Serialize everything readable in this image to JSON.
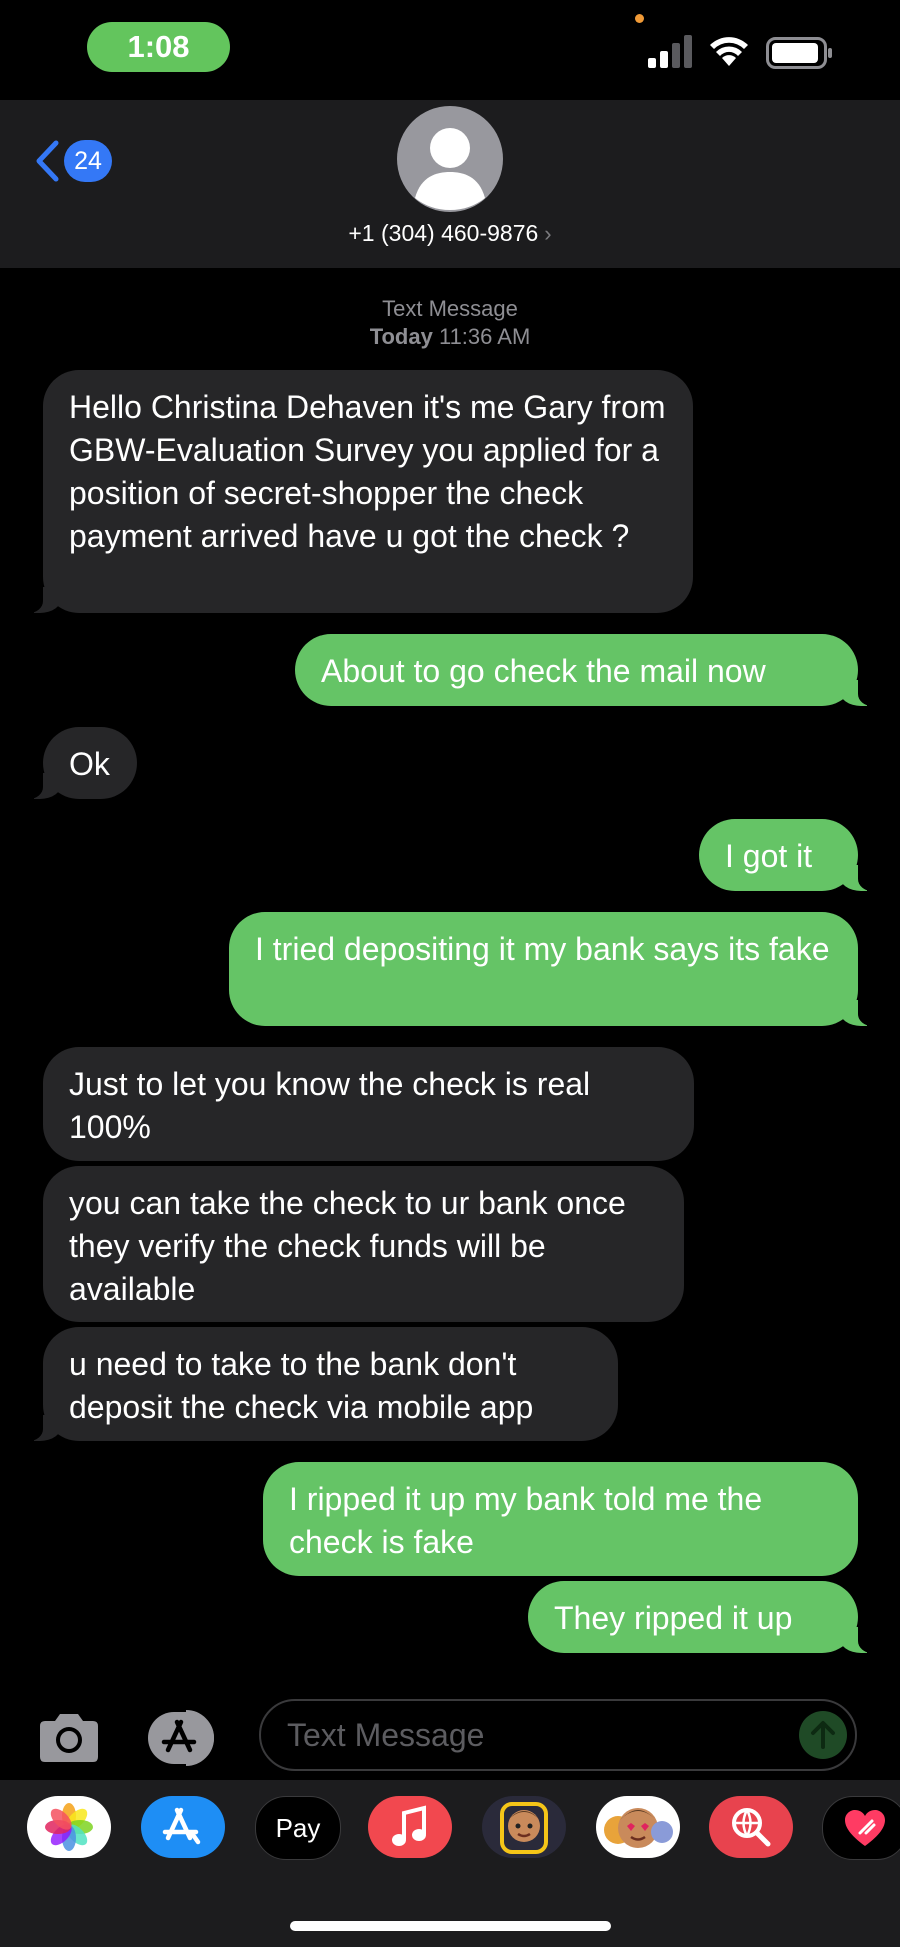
{
  "status_bar": {
    "time": "1:08"
  },
  "header": {
    "back_count": "24",
    "contact_number": "+1 (304) 460-9876",
    "chevron": "›"
  },
  "thread": {
    "service_label": "Text Message",
    "date_label": "Today",
    "time_label": "11:36 AM"
  },
  "messages": [
    {
      "direction": "incoming",
      "text": "Hello Christina Dehaven it's me  Gary from GBW-Evaluation Survey you applied for a position of secret-shopper the check payment arrived have u got the check ?"
    },
    {
      "direction": "outgoing",
      "text": "About to go check the mail now"
    },
    {
      "direction": "incoming",
      "text": "Ok"
    },
    {
      "direction": "outgoing",
      "text": "I got it"
    },
    {
      "direction": "outgoing",
      "text": "I tried depositing it my bank says its fake"
    },
    {
      "direction": "incoming",
      "text": "Just to let you know  the check is real 100%"
    },
    {
      "direction": "incoming",
      "text": "you can take the check to ur bank once they verify the check funds will be available"
    },
    {
      "direction": "incoming",
      "text": "u need to take to the bank don't deposit the check via mobile app"
    },
    {
      "direction": "outgoing",
      "text": "I ripped it up my bank told me the check is fake"
    },
    {
      "direction": "outgoing",
      "text": "They ripped it up"
    }
  ],
  "input": {
    "placeholder": "Text Message"
  },
  "app_drawer": {
    "apps": [
      "photos-app-icon",
      "app-store-icon",
      "apple-pay-icon",
      "music-app-icon",
      "memoji-icon",
      "animoji-stickers-icon",
      "web-images-search-icon",
      "digital-touch-icon"
    ],
    "apple_pay_label": "Pay",
    "apple_pay_logo": ""
  },
  "colors": {
    "incoming_bubble": "#262628",
    "outgoing_bubble": "#65c466",
    "accent": "#3478f6",
    "background": "#000000"
  }
}
